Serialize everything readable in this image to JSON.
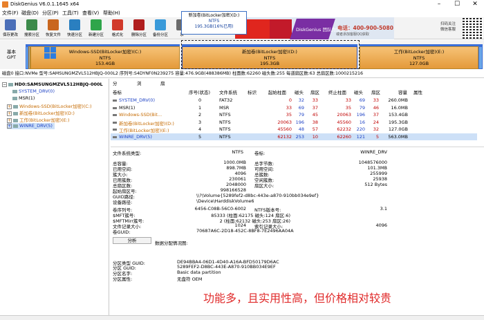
{
  "window": {
    "title": "DiskGenius V6.0.1.1645 x64"
  },
  "menu": [
    "文件(F)",
    "磁盘(D)",
    "分区(P)",
    "工具(T)",
    "查看(V)",
    "帮助(H)"
  ],
  "toolbar": [
    {
      "label": "保存更改",
      "color": "#4b6fb8"
    },
    {
      "label": "搜索分区",
      "color": "#3c8a4a"
    },
    {
      "label": "恢复文件",
      "color": "#c9661e"
    },
    {
      "label": "快速分区",
      "color": "#2a7fc0"
    },
    {
      "label": "新建分区",
      "color": "#2fa54a"
    },
    {
      "label": "格式化",
      "color": "#d1392a"
    },
    {
      "label": "删除分区",
      "color": "#b01e1e"
    },
    {
      "label": "备份分区",
      "color": "#3a9ad9"
    },
    {
      "label": "系",
      "color": "#6b6b6b"
    }
  ],
  "banner": {
    "brand_text": "DiskGenius 团队为您服务",
    "phone": "电话：400-900-5080",
    "qq": "或者添加客服QQ获取"
  },
  "qr_label": [
    "扫码关注",
    "微信客服"
  ],
  "popup": {
    "line1": "新加卷(BitLocker加密)(D:)",
    "line2": "NTFS",
    "line3": "195.3GB(16%已用)"
  },
  "disk_label": [
    "基本",
    "GPT"
  ],
  "segments": [
    {
      "name": "Windows-SSD(BitLocker加密)(C:)",
      "fs": "NTFS",
      "size": "153.4GB"
    },
    {
      "name": "新加卷(BitLocker加密)(D:)",
      "fs": "NTFS",
      "size": "195.3GB"
    },
    {
      "name": "工作(BitLocker加密)(E:)",
      "fs": "NTFS",
      "size": "127.0GB"
    }
  ],
  "disk_info": "磁盘0 接口:NVMe  型号:SAMSUNGMZVL512HBJQ-000L2  序列号:S4DYNF0N239275  容量:476.9GB(488386MB)  柱面数:62260  磁头数:255  每道扇区数:63  总扇区数:1000215216",
  "tree": {
    "disk": "HD0:SAMSUNGMZVL512HBJQ-000L",
    "items": [
      {
        "label": "SYSTEM_DRV(0)",
        "color": "#1a3fc4"
      },
      {
        "label": "MSR(1)",
        "color": "#000000"
      },
      {
        "label": "Windows-SSD(BitLocker加密)(C:)",
        "color": "#c56a00"
      },
      {
        "label": "新加卷(BitLocker加密)(D:)",
        "color": "#c56a00"
      },
      {
        "label": "工作(BitLocker加密)(E:)",
        "color": "#c56a00"
      },
      {
        "label": "WINRE_DRV(5)",
        "color": "#1a3fc4"
      }
    ]
  },
  "tabs": [
    "分区参数",
    "浏览文件",
    "扇区编辑"
  ],
  "columns": [
    "卷标",
    "序号(状态)",
    "文件系统",
    "标识",
    "起始柱面",
    "磁头",
    "扇区",
    "终止柱面",
    "磁头",
    "扇区",
    "容量",
    "属性"
  ],
  "rows": [
    {
      "label": "SYSTEM_DRV(0)",
      "idx": "0",
      "fs": "FAT32",
      "id": "",
      "sc": "0",
      "sh": "32",
      "ss": "33",
      "ec": "33",
      "eh": "69",
      "es": "33",
      "cap": "260.0MB",
      "attr": "",
      "color": "#1a3fc4"
    },
    {
      "label": "MSR(1)",
      "idx": "1",
      "fs": "MSR",
      "id": "",
      "sc": "33",
      "sh": "69",
      "ss": "37",
      "ec": "35",
      "eh": "79",
      "es": "46",
      "cap": "16.0MB",
      "attr": "",
      "color": "#000000"
    },
    {
      "label": "Windows-SSD(Bit...",
      "idx": "2",
      "fs": "NTFS",
      "id": "",
      "sc": "35",
      "sh": "79",
      "ss": "45",
      "ec": "20063",
      "eh": "196",
      "es": "37",
      "cap": "153.4GB",
      "attr": "",
      "color": "#c56a00"
    },
    {
      "label": "新加卷(BitLocker加密)(D:)",
      "idx": "3",
      "fs": "NTFS",
      "id": "",
      "sc": "20063",
      "sh": "196",
      "ss": "38",
      "ec": "45560",
      "eh": "16",
      "es": "24",
      "cap": "195.3GB",
      "attr": "",
      "color": "#c56a00"
    },
    {
      "label": "工作(BitLocker加密)(E:)",
      "idx": "4",
      "fs": "NTFS",
      "id": "",
      "sc": "45560",
      "sh": "48",
      "ss": "57",
      "ec": "62232",
      "eh": "220",
      "es": "32",
      "cap": "127.0GB",
      "attr": "",
      "color": "#c56a00"
    },
    {
      "label": "WINRE_DRV(5)",
      "idx": "5",
      "fs": "NTFS",
      "id": "",
      "sc": "62132",
      "sh": "253",
      "ss": "10",
      "ec": "62260",
      "eh": "121",
      "es": "5",
      "cap": "563.0MB",
      "attr": "",
      "color": "#1a3fc4"
    }
  ],
  "details": {
    "fs_type_label": "文件系统类型:",
    "fs_type": "NTFS",
    "vol_label_label": "卷标:",
    "vol_label": "WINRE_DRV",
    "left": [
      [
        "总容量:",
        "1000.0MB"
      ],
      [
        "已用空间:",
        "898.7MB"
      ],
      [
        "簇大小:",
        "4096"
      ],
      [
        "已用簇数:",
        "230061"
      ],
      [
        "总扇区数:",
        "2048000"
      ],
      [
        "起始扇区号:",
        "998166528"
      ]
    ],
    "right": [
      [
        "总字节数:",
        "1048576000"
      ],
      [
        "可用空间:",
        "101.3MB"
      ],
      [
        "总簇数:",
        "255999"
      ],
      [
        "空闲簇数:",
        "25938"
      ],
      [
        "扇区大小:",
        "512 Bytes"
      ]
    ],
    "guid_path_label": "GUID路径:",
    "guid_path": "\\\\?\\Volume{5289fef2-d8bc-443e-a870-910bb034e9ef}",
    "device_path_label": "设备路径:",
    "device_path": "\\Device\\HarddiskVolume6",
    "serial_label": "卷序列号:",
    "serial": "6456-C08B-56C0-6002",
    "ntfs_ver_label": "NTFS版本号:",
    "ntfs_ver": "3.1",
    "mft_label": "$MFT簇号:",
    "mft": "85333 (柱面:62175 磁头:124 扇区:6)",
    "mftmirr_label": "$MFTMirr簇号:",
    "mftmirr": "2 (柱面:62132 磁头:253 扇区:26)",
    "frs_label": "文件记录大小:",
    "frs": "1024",
    "idx_label": "索引记录大小:",
    "idx": "4096",
    "vguid_label": "卷GUID:",
    "vguid": "70687A6C-2D18-452C-8BF8-7E2496AA04A",
    "analyze": "分析",
    "alloc_label": "数据分配情况图:",
    "ptype_label": "分区类型 GUID:",
    "ptype": "DE94BBA4-06D1-4D40-A16A-BFD50179D6AC",
    "pguid_label": "分区 GUID:",
    "pguid": "5289FEF2-D8BC-443E-A870-910BB034E9EF",
    "pname_label": "分区名字:",
    "pname": "Basic data partition",
    "pattr_label": "分区属性:",
    "pattr": "无盘符 OEM"
  },
  "caption": "功能多，且实用性高，但价格相对较贵"
}
